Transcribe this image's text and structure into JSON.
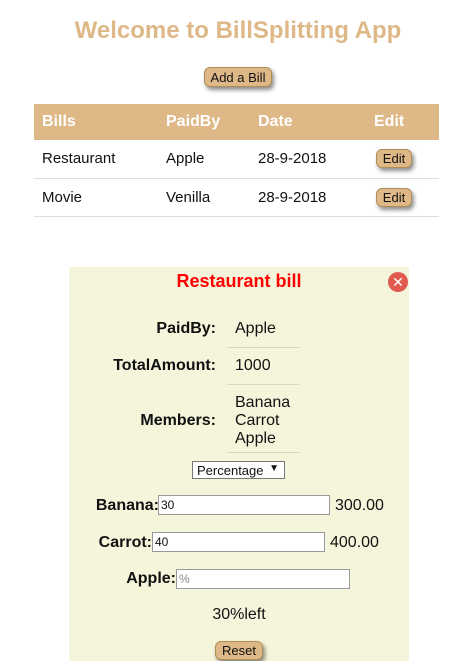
{
  "app": {
    "title": "Welcome to BillSplitting App",
    "accent_color": "#deb887"
  },
  "actions": {
    "add_bill_label": "Add a Bill"
  },
  "bills_table": {
    "headers": [
      "Bills",
      "PaidBy",
      "Date",
      "Edit"
    ],
    "rows": [
      {
        "bill": "Restaurant",
        "paid_by": "Apple",
        "date": "28-9-2018",
        "edit_label": "Edit"
      },
      {
        "bill": "Movie",
        "paid_by": "Venilla",
        "date": "28-9-2018",
        "edit_label": "Edit"
      }
    ]
  },
  "bill_detail": {
    "title": "Restaurant bill",
    "title_color": "#ff0000",
    "close_icon": "close-icon",
    "paid_by_label": "PaidBy:",
    "paid_by_value": "Apple",
    "total_label": "TotalAmount:",
    "total_value": "1000",
    "members_label": "Members:",
    "members": [
      "Banana",
      "Carrot",
      "Apple"
    ],
    "split_mode": {
      "selected": "Percentage"
    },
    "splits": [
      {
        "label": "Banana:",
        "value": "30",
        "placeholder": "%",
        "amount": "300.00"
      },
      {
        "label": "Carrot:",
        "value": "40",
        "placeholder": "%",
        "amount": "400.00"
      },
      {
        "label": "Apple:",
        "value": "",
        "placeholder": "%",
        "amount": ""
      }
    ],
    "remaining_text": "30%left",
    "reset_label": "Reset"
  }
}
